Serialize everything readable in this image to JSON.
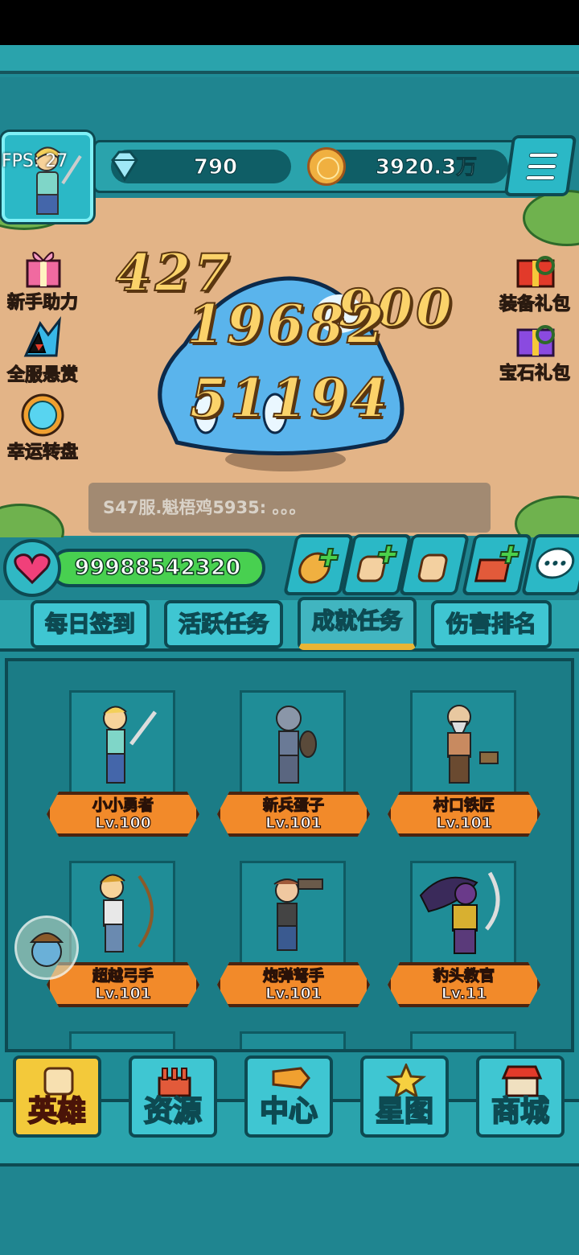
{
  "hud": {
    "fps": "FPS: 27",
    "gems": "790",
    "gold": "3920.3万"
  },
  "side_left": [
    {
      "label": "新手助力",
      "icon": "gift-icon"
    },
    {
      "label": "全服悬赏",
      "icon": "bounty-icon"
    },
    {
      "label": "幸运转盘",
      "icon": "wheel-icon"
    }
  ],
  "side_right": [
    {
      "label": "装备礼包",
      "icon": "equipment-gift-icon"
    },
    {
      "label": "宝石礼包",
      "icon": "gem-gift-icon"
    }
  ],
  "damage_numbers": [
    "427",
    "900",
    "19682",
    "51194"
  ],
  "chat": {
    "message": "S47服.魁梧鸡5935: 。。。"
  },
  "player": {
    "hp": "99988542320"
  },
  "tabs": [
    {
      "label": "每日签到",
      "active": false
    },
    {
      "label": "活跃任务",
      "active": false
    },
    {
      "label": "成就任务",
      "active": true
    },
    {
      "label": "伤害排名",
      "active": false
    }
  ],
  "heroes": [
    {
      "name": "小小勇者",
      "level": "Lv.100"
    },
    {
      "name": "新兵蛋子",
      "level": "Lv.101"
    },
    {
      "name": "村口铁匠",
      "level": "Lv.101"
    },
    {
      "name": "超越弓手",
      "level": "Lv.101"
    },
    {
      "name": "炮弹弩手",
      "level": "Lv.101"
    },
    {
      "name": "豹头教官",
      "level": "Lv.11"
    }
  ],
  "nav": [
    {
      "label": "英雄",
      "active": true
    },
    {
      "label": "资源",
      "active": false
    },
    {
      "label": "中心",
      "active": false
    },
    {
      "label": "星图",
      "active": false
    },
    {
      "label": "商城",
      "active": false
    }
  ],
  "colors": {
    "teal_frame": "#2aa3ac",
    "dark_outline": "#0d4a52",
    "field": "#e3b487",
    "hp_green": "#48d050",
    "banner_orange": "#f28a2a",
    "active_gold": "#f3c93a",
    "damage_gold": "#fbd36a"
  }
}
